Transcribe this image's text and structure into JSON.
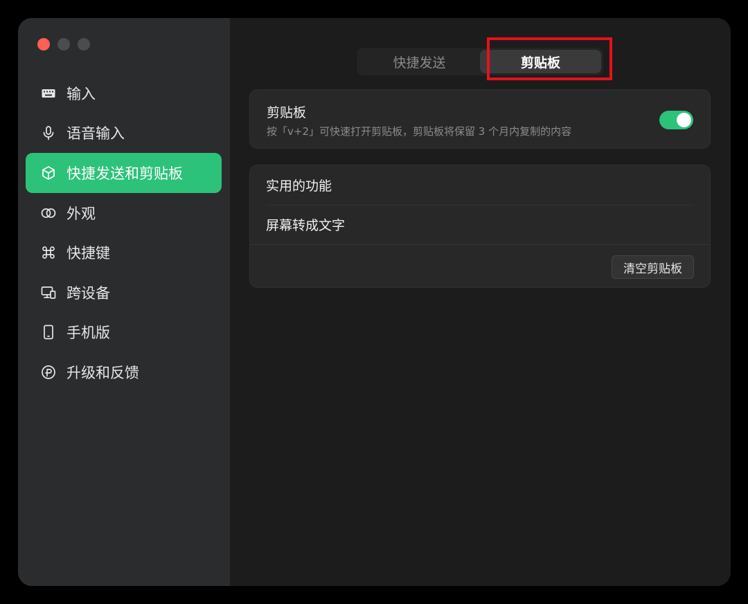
{
  "window": {
    "traffic_lights": [
      "close",
      "minimize",
      "zoom"
    ]
  },
  "sidebar": {
    "items": [
      {
        "label": "输入",
        "icon": "keyboard-icon"
      },
      {
        "label": "语音输入",
        "icon": "microphone-icon"
      },
      {
        "label": "快捷发送和剪贴板",
        "icon": "cube-icon",
        "active": true
      },
      {
        "label": "外观",
        "icon": "circles-icon"
      },
      {
        "label": "快捷键",
        "icon": "command-icon"
      },
      {
        "label": "跨设备",
        "icon": "devices-icon"
      },
      {
        "label": "手机版",
        "icon": "phone-icon"
      },
      {
        "label": "升级和反馈",
        "icon": "feedback-icon"
      }
    ]
  },
  "tabs": {
    "items": [
      {
        "label": "快捷发送"
      },
      {
        "label": "剪贴板",
        "selected": true
      }
    ]
  },
  "clipboard": {
    "title": "剪贴板",
    "description": "按「v+2」可快速打开剪贴板，剪贴板将保留 3 个月内复制的内容",
    "enabled": true
  },
  "features": {
    "row1": "实用的功能",
    "row2": "屏幕转成文字",
    "clear_button": "清空剪贴板"
  },
  "colors": {
    "accent": "#2cc27a",
    "highlight_box": "#e8101c",
    "sidebar_bg": "#2b2c2e",
    "main_bg": "#1c1c1c"
  }
}
